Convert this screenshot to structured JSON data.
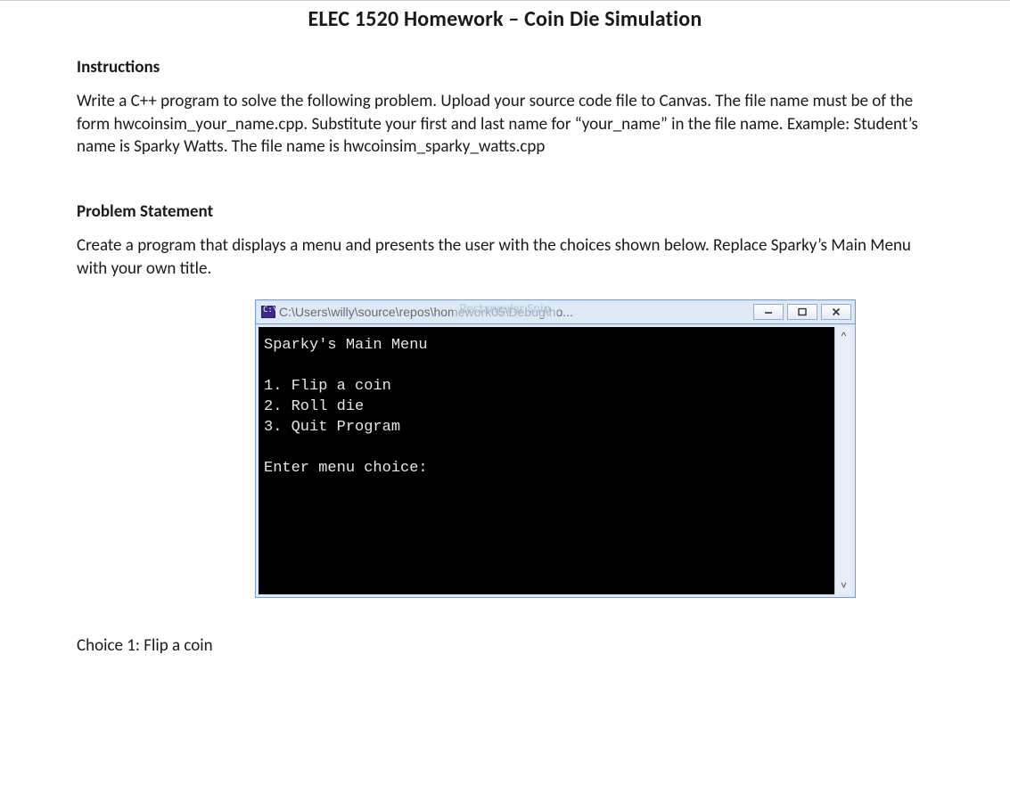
{
  "title": "ELEC 1520 Homework – Coin Die Simulation",
  "instructions_heading": "Instructions",
  "instructions_body": "Write a C++ program to solve the following problem. Upload your source code file to Canvas. The file name must be of the form hwcoinsim_your_name.cpp.  Substitute your first and last name for “your_name” in the file name. Example: Student’s name is Sparky Watts. The file name is hwcoinsim_sparky_watts.cpp",
  "problem_heading": "Problem Statement",
  "problem_body": "Create a program that displays a menu and presents the user with the choices shown below. Replace Sparky’s Main Menu with your own title.",
  "watermark": "Rectangular Snip",
  "console": {
    "title_path": "C:\\Users\\willy\\source\\repos\\homework05\\Debug\\ho...",
    "menu_title": "Sparky's Main Menu",
    "line1": "1. Flip a coin",
    "line2": "2. Roll die",
    "line3": "3. Quit Program",
    "prompt": "Enter menu choice:",
    "scroll_up": "^",
    "scroll_down": "˅"
  },
  "choice1_heading": "Choice 1: Flip a coin"
}
